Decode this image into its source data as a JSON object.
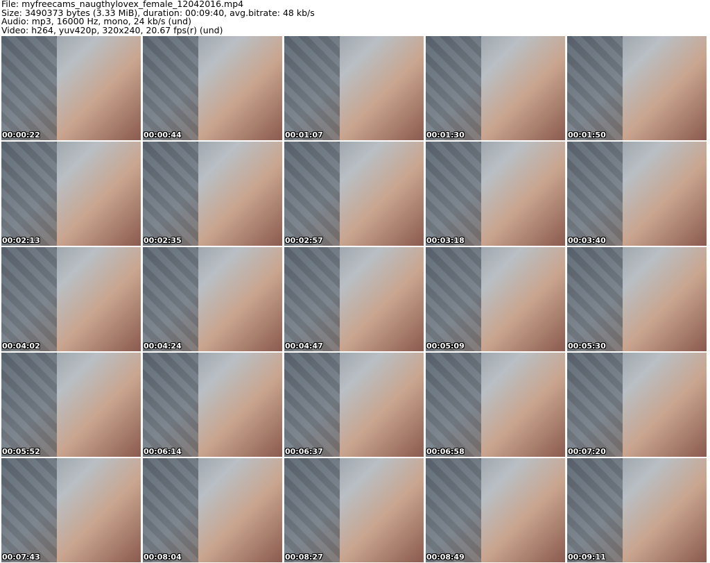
{
  "info": {
    "file": "File: myfreecams_naugthylovex_female_12042016.mp4",
    "size": "Size: 3490373 bytes (3.33 MiB), duration: 00:09:40, avg.bitrate: 48 kb/s",
    "audio": "Audio: mp3, 16000 Hz, mono, 24 kb/s (und)",
    "video": "Video: h264, yuv420p, 320x240, 20.67 fps(r) (und)"
  },
  "frames": [
    "00:00:22",
    "00:00:44",
    "00:01:07",
    "00:01:30",
    "00:01:50",
    "00:02:13",
    "00:02:35",
    "00:02:57",
    "00:03:18",
    "00:03:40",
    "00:04:02",
    "00:04:24",
    "00:04:47",
    "00:05:09",
    "00:05:30",
    "00:05:52",
    "00:06:14",
    "00:06:37",
    "00:06:58",
    "00:07:20",
    "00:07:43",
    "00:08:04",
    "00:08:27",
    "00:08:49",
    "00:09:11"
  ]
}
